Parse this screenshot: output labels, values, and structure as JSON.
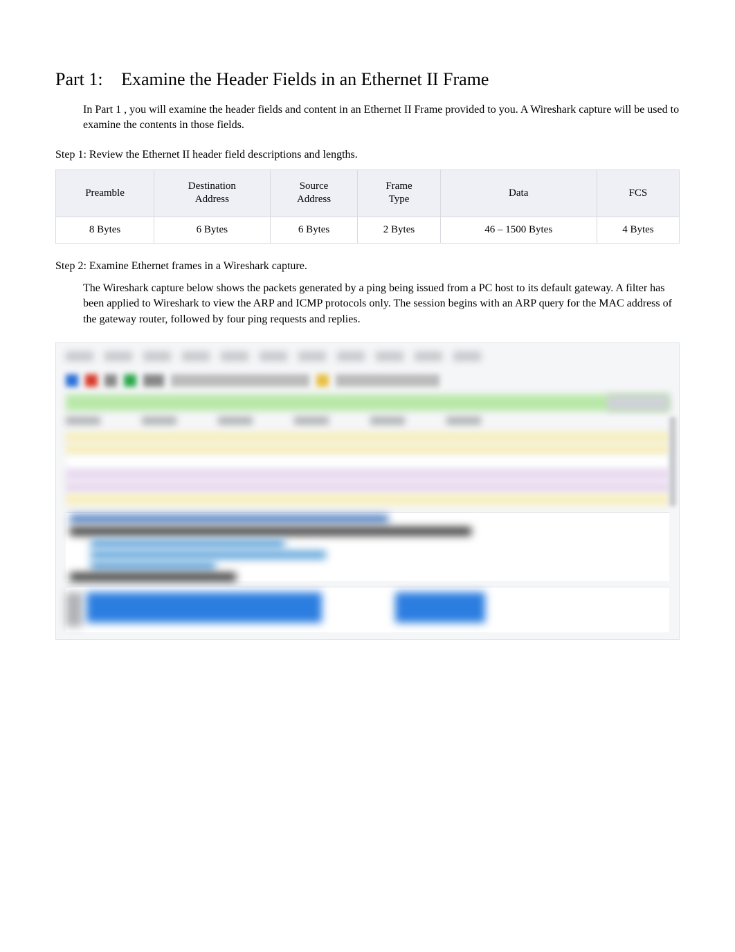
{
  "part": {
    "number": "Part 1:",
    "title": "Examine the Header Fields in an Ethernet II Frame",
    "intro_prefix": "In ",
    "intro_bold1": "Part 1",
    "intro_mid1": " , you will examine the header fields and content in an ",
    "intro_bold2": "Ethernet II Frame",
    "intro_mid2": " provided to you. A ",
    "intro_bold3": "Wireshark",
    "intro_end": " capture will be used to examine the contents in those fields."
  },
  "step1": {
    "title": "Step 1: Review the Ethernet II header field descriptions and lengths.",
    "headers": {
      "h1": "Preamble",
      "h2a": "Destination",
      "h2b": "Address",
      "h3a": "Source",
      "h3b": "Address",
      "h4a": "Frame",
      "h4b": "Type",
      "h5": "Data",
      "h6": "FCS"
    },
    "values": {
      "v1": "8 Bytes",
      "v2": "6 Bytes",
      "v3": "6 Bytes",
      "v4": "2 Bytes",
      "v5": "46 – 1500 Bytes",
      "v6": "4 Bytes"
    }
  },
  "step2": {
    "title": "Step 2: Examine Ethernet frames in a Wireshark capture.",
    "p_prefix": "The ",
    "p_bold1": "Wireshark",
    "p_mid1": " capture below shows the packets generated by a ping being issued from a PC host to its default gateway. A filter has been applied to Wireshark to view the ",
    "p_bold2": "ARP",
    "p_mid2": " and ",
    "p_bold3": "ICMP",
    "p_mid3": " protocols only. The session begins with an ",
    "p_bold4": "ARP",
    "p_end": " query for the MAC address of the gateway router, followed by four ping requests and replies."
  }
}
